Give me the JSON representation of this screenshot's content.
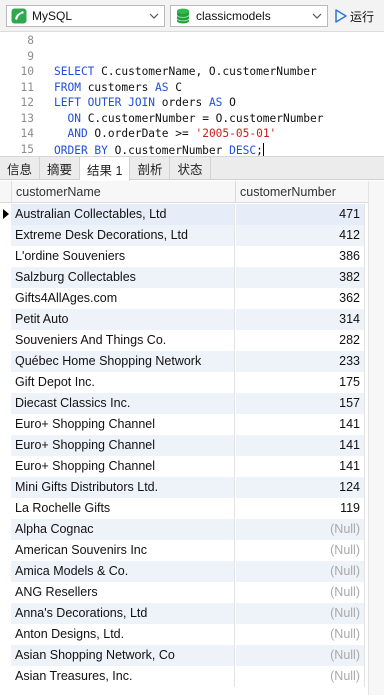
{
  "toolbar": {
    "connection": "MySQL",
    "database": "classicmodels",
    "run_label": "运行"
  },
  "editor": {
    "lines": [
      {
        "num": "8",
        "tokens": []
      },
      {
        "num": "9",
        "tokens": []
      },
      {
        "num": "10",
        "tokens": [
          {
            "t": "SELECT ",
            "c": "kw"
          },
          {
            "t": "C.customerName, O.customerNumber",
            "c": "tx"
          }
        ]
      },
      {
        "num": "11",
        "tokens": [
          {
            "t": "FROM ",
            "c": "kw"
          },
          {
            "t": "customers ",
            "c": "tx"
          },
          {
            "t": "AS ",
            "c": "kw"
          },
          {
            "t": "C",
            "c": "tx"
          }
        ]
      },
      {
        "num": "12",
        "tokens": [
          {
            "t": "LEFT OUTER JOIN ",
            "c": "kw"
          },
          {
            "t": "orders ",
            "c": "tx"
          },
          {
            "t": "AS ",
            "c": "kw"
          },
          {
            "t": "O",
            "c": "tx"
          }
        ]
      },
      {
        "num": "13",
        "tokens": [
          {
            "t": "  ON ",
            "c": "kw"
          },
          {
            "t": "C.customerNumber = O.customerNumber",
            "c": "tx"
          }
        ]
      },
      {
        "num": "14",
        "tokens": [
          {
            "t": "  AND ",
            "c": "kw"
          },
          {
            "t": "O.orderDate >= ",
            "c": "tx"
          },
          {
            "t": "'2005-05-01'",
            "c": "str"
          }
        ]
      },
      {
        "num": "15",
        "tokens": [
          {
            "t": "ORDER BY ",
            "c": "kw"
          },
          {
            "t": "O.customerNumber ",
            "c": "tx"
          },
          {
            "t": "DESC",
            "c": "kw"
          },
          {
            "t": ";",
            "c": "tx"
          }
        ]
      }
    ]
  },
  "tabs": [
    {
      "label": "信息",
      "active": false
    },
    {
      "label": "摘要",
      "active": false
    },
    {
      "label": "结果 1",
      "active": true
    },
    {
      "label": "剖析",
      "active": false
    },
    {
      "label": "状态",
      "active": false
    }
  ],
  "grid": {
    "columns": [
      "customerName",
      "customerNumber"
    ],
    "rows": [
      [
        "Australian Collectables, Ltd",
        "471"
      ],
      [
        "Extreme Desk Decorations, Ltd",
        "412"
      ],
      [
        "L'ordine Souveniers",
        "386"
      ],
      [
        "Salzburg Collectables",
        "382"
      ],
      [
        "Gifts4AllAges.com",
        "362"
      ],
      [
        "Petit Auto",
        "314"
      ],
      [
        "Souveniers And Things Co.",
        "282"
      ],
      [
        "Québec Home Shopping Network",
        "233"
      ],
      [
        "Gift Depot Inc.",
        "175"
      ],
      [
        "Diecast Classics Inc.",
        "157"
      ],
      [
        "Euro+ Shopping Channel",
        "141"
      ],
      [
        "Euro+ Shopping Channel",
        "141"
      ],
      [
        "Euro+ Shopping Channel",
        "141"
      ],
      [
        "Mini Gifts Distributors Ltd.",
        "124"
      ],
      [
        "La Rochelle Gifts",
        "119"
      ],
      [
        "Alpha Cognac",
        "(Null)"
      ],
      [
        "American Souvenirs Inc",
        "(Null)"
      ],
      [
        "Amica Models & Co.",
        "(Null)"
      ],
      [
        "ANG Resellers",
        "(Null)"
      ],
      [
        "Anna's Decorations, Ltd",
        "(Null)"
      ],
      [
        "Anton Designs, Ltd.",
        "(Null)"
      ],
      [
        "Asian Shopping Network, Co",
        "(Null)"
      ],
      [
        "Asian Treasures, Inc.",
        "(Null)"
      ]
    ]
  },
  "colors": {
    "keyword": "#1f4fd6",
    "string": "#c81e1e",
    "null": "#a9a9a9",
    "row_alt": "#eef3fa",
    "mysql_icon": "#2fa84f",
    "db_icon": "#1fa23a",
    "run_icon": "#2b78d6"
  },
  "icons": {
    "connection": "mysql-connection-icon",
    "database": "database-icon",
    "run": "play-icon",
    "dropdown": "chevron-down-icon",
    "row_marker": "current-row-marker-icon"
  }
}
